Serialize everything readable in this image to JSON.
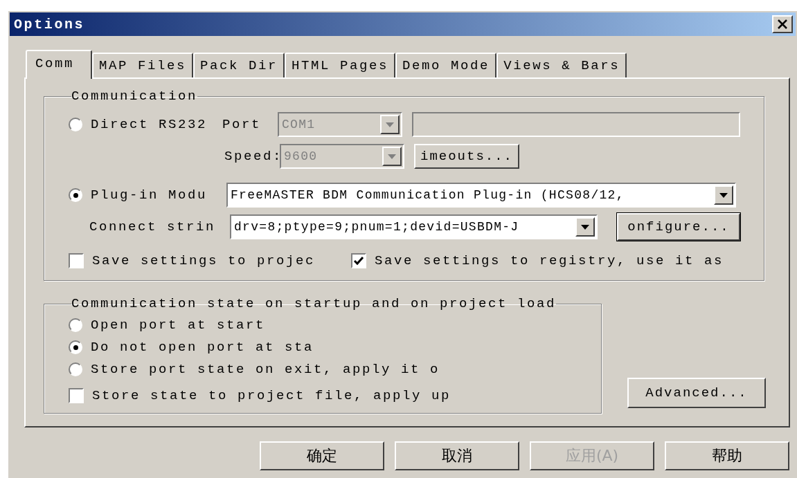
{
  "window": {
    "title": "Options"
  },
  "tabs": [
    {
      "label": "Comm",
      "selected": true
    },
    {
      "label": "MAP Files",
      "selected": false
    },
    {
      "label": "Pack Dir",
      "selected": false
    },
    {
      "label": "HTML Pages",
      "selected": false
    },
    {
      "label": "Demo Mode",
      "selected": false
    },
    {
      "label": "Views & Bars",
      "selected": false
    }
  ],
  "communication": {
    "label": "Communication",
    "direct": {
      "label": "Direct RS232",
      "selected": false
    },
    "port": {
      "label": "Port",
      "value": "COM1",
      "disabled": true
    },
    "speed": {
      "label": "Speed:",
      "value": "9600",
      "disabled": true
    },
    "timeouts_button": "imeouts...",
    "plugin": {
      "label": "Plug-in Modu",
      "selected": true,
      "value": "FreeMASTER BDM Communication Plug-in (HCS08/12,"
    },
    "connect": {
      "label": "Connect strin",
      "value": "drv=8;ptype=9;pnum=1;devid=USBDM-J"
    },
    "configure_button": "onfigure...",
    "checkboxes": [
      {
        "label": "Save settings to projec",
        "checked": false
      },
      {
        "label": "Save settings to registry, use it as",
        "checked": true
      }
    ]
  },
  "startup": {
    "label": "Communication state on startup and on project load",
    "options": [
      {
        "kind": "radio",
        "label": "Open port at start",
        "selected": false
      },
      {
        "kind": "radio",
        "label": "Do not open port at sta",
        "selected": true
      },
      {
        "kind": "radio",
        "label": "Store port state on exit, apply it o",
        "selected": false
      },
      {
        "kind": "checkbox",
        "label": "Store state to project file, apply up",
        "checked": false
      }
    ]
  },
  "advanced_button": "Advanced...",
  "buttons": [
    {
      "label": "确定",
      "disabled": false
    },
    {
      "label": "取消",
      "disabled": false
    },
    {
      "label": "应用(A)",
      "disabled": true
    },
    {
      "label": "帮助",
      "disabled": false
    }
  ]
}
